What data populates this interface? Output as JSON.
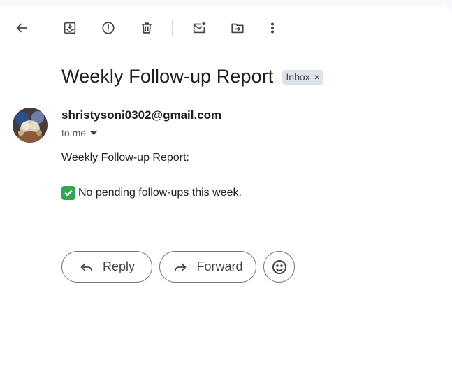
{
  "toolbar": {
    "items": [
      "back",
      "archive",
      "report-spam",
      "delete",
      "mark-unread",
      "move-to",
      "more"
    ]
  },
  "email": {
    "subject": "Weekly Follow-up Report",
    "label": "Inbox",
    "label_remove": "×",
    "sender": "shristysoni0302@gmail.com",
    "recipient": "to me",
    "body_line1": "Weekly Follow-up Report:",
    "body_line2": "No pending follow-ups this week."
  },
  "actions": {
    "reply_label": "Reply",
    "forward_label": "Forward"
  },
  "colors": {
    "check_emoji": "#2fa84f",
    "chip_bg": "#dde3ea",
    "icon": "#444746"
  }
}
